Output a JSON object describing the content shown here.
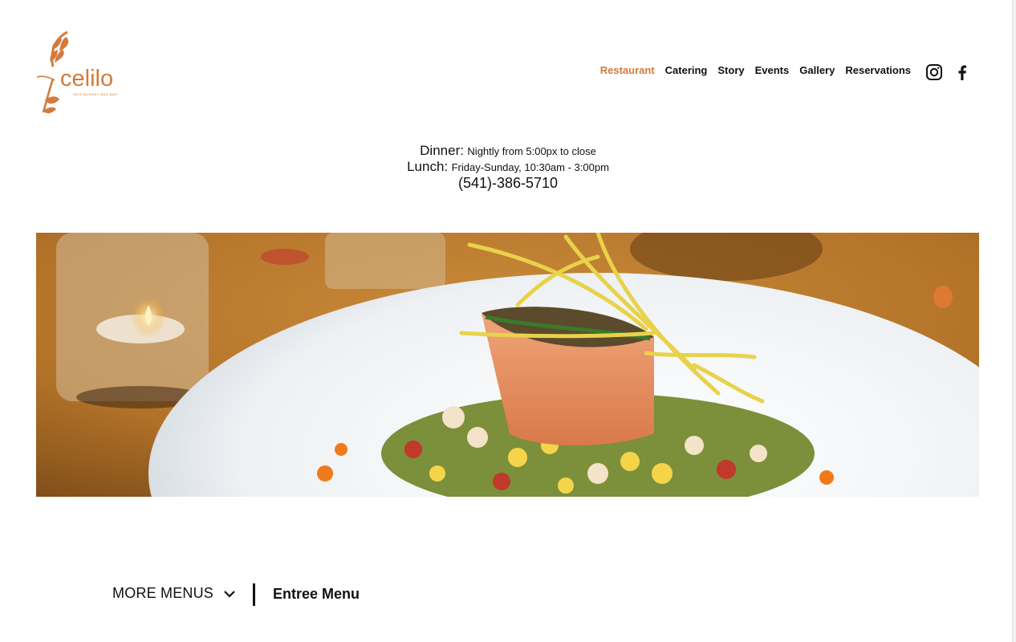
{
  "brand": {
    "name": "celilo",
    "tagline": "RESTAURANT AND BAR",
    "accent_color": "#d27b3c"
  },
  "nav": {
    "items": [
      {
        "label": "Restaurant",
        "active": true
      },
      {
        "label": "Catering",
        "active": false
      },
      {
        "label": "Story",
        "active": false
      },
      {
        "label": "Events",
        "active": false
      },
      {
        "label": "Gallery",
        "active": false
      },
      {
        "label": "Reservations",
        "active": false
      }
    ],
    "social": [
      "instagram-icon",
      "facebook-icon"
    ]
  },
  "info": {
    "dinner_label": "Dinner:",
    "dinner_text": "Nightly from 5:00px to close",
    "lunch_label": "Lunch:",
    "lunch_text": "Friday-Sunday, 10:30am - 3:00pm",
    "phone": "(541)-386-5710"
  },
  "hero": {
    "subject": "plated salmon dish with candle"
  },
  "menus": {
    "more_label": "MORE MENUS",
    "current_label": "Entree Menu"
  }
}
